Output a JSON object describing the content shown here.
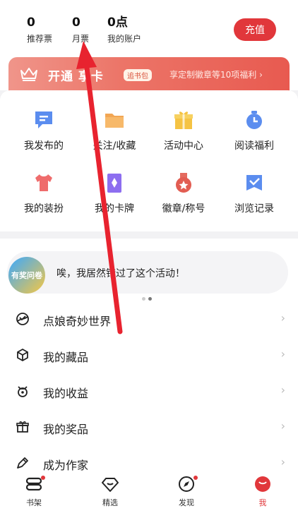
{
  "stats": [
    {
      "value": "0",
      "label": "推荐票"
    },
    {
      "value": "0",
      "label": "月票"
    },
    {
      "value": "0点",
      "label": "我的账户"
    }
  ],
  "recharge_label": "充值",
  "vip": {
    "title": "开通 享卡",
    "tag": "追书包",
    "benefit": "享定制徽章等10项福利 ›"
  },
  "grid": [
    {
      "label": "我发布的",
      "icon": "post-icon"
    },
    {
      "label": "关注/收藏",
      "icon": "folder-icon"
    },
    {
      "label": "活动中心",
      "icon": "gift-icon"
    },
    {
      "label": "阅读福利",
      "icon": "timer-icon"
    },
    {
      "label": "我的装扮",
      "icon": "shirt-icon"
    },
    {
      "label": "我的卡牌",
      "icon": "card-icon"
    },
    {
      "label": "徽章/称号",
      "icon": "medal-icon"
    },
    {
      "label": "浏览记录",
      "icon": "history-icon"
    }
  ],
  "activity": {
    "badge_text": "有奖问卷",
    "text": "唉，我居然错过了这个活动！"
  },
  "menu": [
    {
      "label": "点娘奇妙世界",
      "icon": "world-icon"
    },
    {
      "label": "我的藏品",
      "icon": "cube-icon"
    },
    {
      "label": "我的收益",
      "icon": "earnings-icon"
    },
    {
      "label": "我的奖品",
      "icon": "prize-icon"
    },
    {
      "label": "成为作家",
      "icon": "pen-icon"
    }
  ],
  "tabs": [
    {
      "label": "书架",
      "icon": "bookshelf-icon",
      "dot": true
    },
    {
      "label": "精选",
      "icon": "diamond-icon",
      "dot": false
    },
    {
      "label": "发现",
      "icon": "compass-icon",
      "dot": true
    },
    {
      "label": "我",
      "icon": "profile-icon",
      "dot": false
    }
  ],
  "colors": {
    "accent": "#e1373b",
    "vip_gradient_start": "#f0958a",
    "vip_gradient_end": "#e85a50",
    "annotation_arrow": "#e8232f"
  }
}
